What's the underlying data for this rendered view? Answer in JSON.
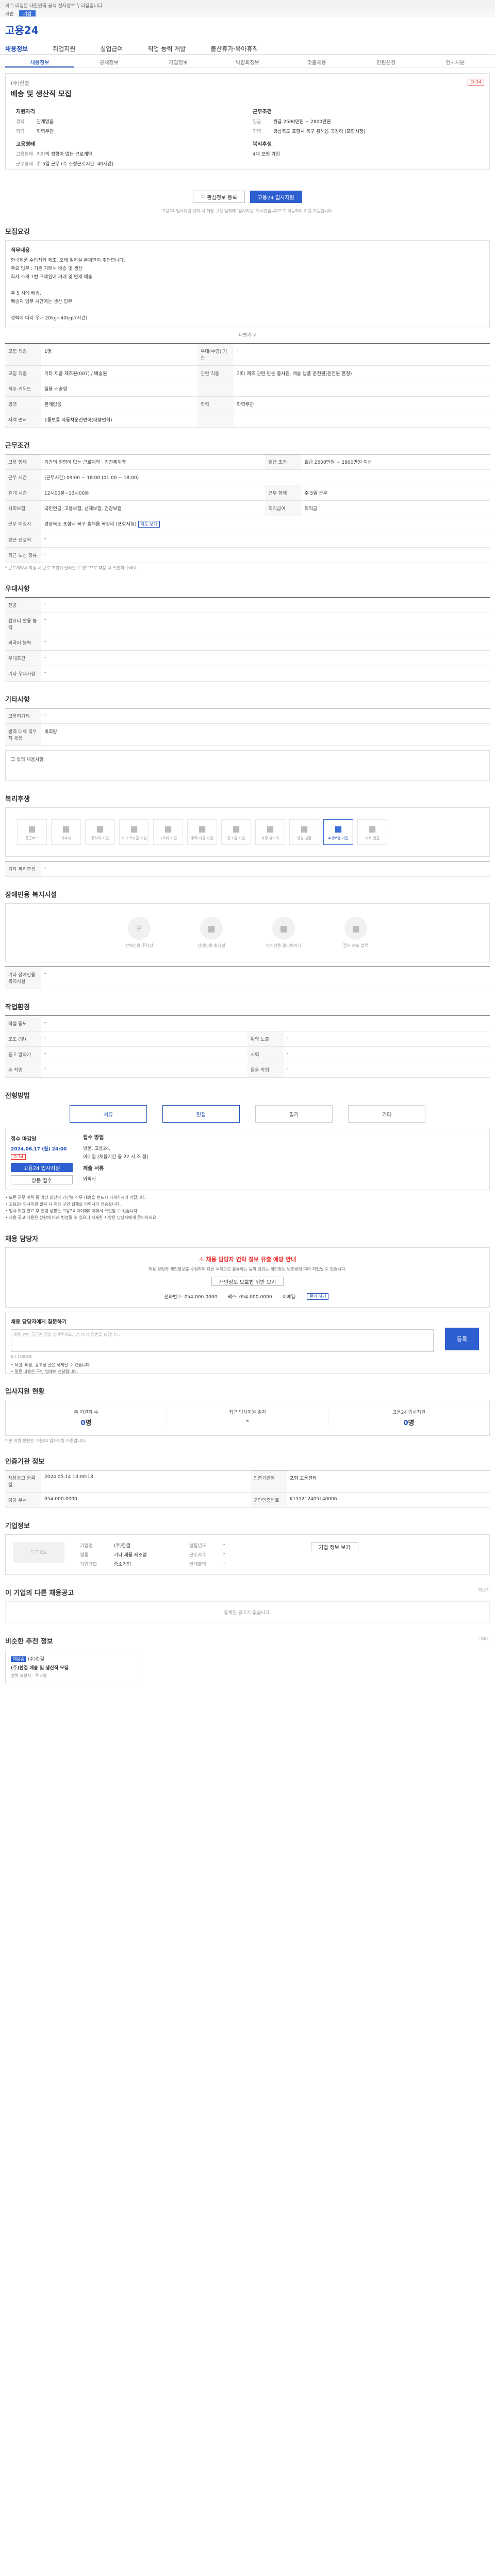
{
  "top": {
    "notice": "이 누리집은 대한민국 공식 전자정부 누리집입니다.",
    "tabs": [
      "개인",
      "기업"
    ],
    "logo": "고용24",
    "gnb": [
      "채용정보",
      "취업지원",
      "실업급여",
      "직업 능력 개발",
      "출산휴가·육아휴직"
    ],
    "subnav": [
      "채용정보",
      "공채정보",
      "기업정보",
      "박람회정보",
      "맞춤채용",
      "민원신청",
      "인사처분"
    ]
  },
  "job": {
    "company": "(주)한결",
    "title": "배송 및 생산직 모집",
    "dday": "D-34",
    "summary_h1": "지원자격",
    "summary_h2": "근무조건",
    "rows_left": [
      {
        "k": "경력",
        "v": "관계없음"
      },
      {
        "k": "학력",
        "v": "학력무관"
      }
    ],
    "form_h": "고용형태",
    "form_rows": [
      {
        "k": "고용형태",
        "v": "기간의 정함이 없는 근로계약"
      },
      {
        "k": "근무형태",
        "v": "주 5일 근무 (주 소정근로시간: 40시간)"
      }
    ],
    "rows_right": [
      {
        "k": "임금",
        "v": "월급 2500만원 ~ 2800만원"
      },
      {
        "k": "지역",
        "v": "경상북도 포항시 북구 흥해읍 곡강리 (포항시청)"
      }
    ],
    "welfare_h": "복리후생",
    "welfare": "4대 보험 가입",
    "btn_scrap": "관심정보 등록",
    "btn_apply": "고용24 입사지원",
    "notice": "고용24 입사지원 선택 시 해당 구인 업체에 ‘입사지원’ 하시겠습니까? 로 이동하여 지원 가능합니다."
  },
  "recruit": {
    "h": "모집요강",
    "desc_h": "직무내용",
    "desc": "한국제품 수입처와 제조, 오래 일하실 분께만이 추천합니다.\n주요 업무 : 기존 거래처 배송 및 생산\n회사 소개 1번 프레임에 거래 및 면세 배송\n\n주 5 시에 배송,\n배송지 업무 시간에는 생산 업무\n\n경력에 따라 우대 20kg~40kg(7시간)",
    "more": "더보기 ∨",
    "table": [
      {
        "k": "모집 직종",
        "v": "1명",
        "k2": "우대(수령) 기간",
        "v2": "-"
      },
      {
        "k": "모집 직종",
        "v": "기타 제품 제조원(007) / 배송원",
        "k2": "관련 직종",
        "v2": "기타 제조 관련 단순 종사원, 배송 납품 운전원(운전원 한정)"
      },
      {
        "k": "직무 키워드",
        "v": "일용 배송업",
        "k2": "",
        "v2": ""
      },
      {
        "k": "경력",
        "v": "관계없음",
        "k2": "학력",
        "v2": "학력무관"
      },
      {
        "k": "자격 면허",
        "v": "1종보통 자동차운전면허(대형면허)",
        "k2": "",
        "v2": ""
      }
    ]
  },
  "work": {
    "h": "근무조건",
    "table": [
      {
        "k": "고용 형태",
        "v": "기간의 정함이 없는 근로계약 · 기간제계약",
        "k2": "임금 조건",
        "v2": "월급 2500만원 ~ 2800만원 이상"
      },
      {
        "k": "근무 시간",
        "v": "(근무시간) 09:00 ~ 18:00 (01:00 ~ 18:00)",
        "k2": "",
        "v2": ""
      },
      {
        "k": "휴게 시간",
        "v": "12시00분~13시00분",
        "k2": "근무 형태",
        "v2": "주 5일 근무"
      },
      {
        "k": "사회보험",
        "v": "국민연금, 고용보험, 산재보험, 건강보험",
        "k2": "퇴직급여",
        "v2": "퇴직금"
      },
      {
        "k": "근무 예정지",
        "v": "경상북도 포항시 북구 흥해읍 곡강리 (포항시청)",
        "k2": "",
        "v2": ""
      },
      {
        "k": "인근 전철역",
        "v": "-",
        "k2": "",
        "v2": ""
      },
      {
        "k": "최근 노선 정류",
        "v": "-",
        "k2": "",
        "v2": ""
      }
    ],
    "note": "* 근로계약서 작성 시 근로 조건이 달라질 수 있으므로 채용 시 확인해 주세요.",
    "map_btn": "지도 보기"
  },
  "pref": {
    "h": "우대사항",
    "table": [
      {
        "k": "전공",
        "v": "-"
      },
      {
        "k": "컴퓨터 활용 능력",
        "v": "-"
      },
      {
        "k": "외국어 능력",
        "v": "-"
      },
      {
        "k": "우대조건",
        "v": "-"
      },
      {
        "k": "기타 우대사항",
        "v": "-"
      }
    ]
  },
  "etc": {
    "h": "기타사항",
    "table": [
      {
        "k": "고용허가제",
        "v": "-"
      },
      {
        "k": "병역 대체 복무자 채용",
        "v": "비희망"
      }
    ],
    "box": "그 밖의 채용사항"
  },
  "welfare": {
    "h": "복리후생",
    "items": [
      "통근버스",
      "기숙사",
      "중식비 지원",
      "자녀 학자금 지원",
      "교육비 지원",
      "주택 자금 지원",
      "경조금 지원",
      "차량 유지비",
      "생일 선물",
      "4대보험 가입",
      "퇴직 연금"
    ],
    "active_index": 9,
    "other_k": "기타 복리후생",
    "other_v": "-"
  },
  "disabled": {
    "h": "장애인용 복지시설",
    "items": [
      "장애인용 주차장",
      "장애인용 화장실",
      "장애인용 엘리베이터",
      "점자 보도 블럭"
    ],
    "other_k": "기타 장애인용 복지시설",
    "other_v": "-"
  },
  "env": {
    "h": "작업환경",
    "rows": [
      {
        "k": "작업 동도",
        "v": "-"
      },
      {
        "k": "조도 (빛)",
        "v": "-",
        "k2": "위험 노출",
        "v2": "-"
      },
      {
        "k": "듣고 말하기",
        "v": "-",
        "k2": "시력",
        "v2": "-"
      },
      {
        "k": "손 작업",
        "v": "-",
        "k2": "들을 작업",
        "v2": "-"
      }
    ]
  },
  "process": {
    "h": "전형방법",
    "steps": [
      "서류",
      "면접",
      "필기",
      "기타"
    ],
    "active": [
      0,
      1
    ],
    "apply_h": "접수 마감일",
    "apply_date": "2024.06.17 (월) 24:00",
    "apply_dd": "D-34",
    "apply_btn": "고용24 입사지원",
    "apply_btn2": "방문 접수",
    "method_h": "접수 방법",
    "method": "방문, 고용24,\n이메일 (채용기간 등 22 시 조 정)",
    "docs_h": "제출 서류",
    "docs": "이력서",
    "bullets": [
      "• 모든 근무 이력 중 가장 최신의 기간별 직무 내용을 반드시 기재하시기 바랍니다.",
      "• 고용24 입사지원 클릭 시 해당 구인 업체로 이력서가 전송됩니다.",
      "• 입사 지원 완료 후 진행 상황은 고용24 마이페이지에서 확인할 수 있습니다.",
      "• 채용 공고 내용은 상황에 따라 변경될 수 있으니 자세한 사항은 담당자에게 문의하세요."
    ]
  },
  "manager": {
    "h": "채용 담당자",
    "warn_title": "채용 담당자 연락 정보 유출 예방 안내",
    "warn_text": "채용 담당자 개인정보를 수집하여 다른 목적으로 활용하는 등의 행위는 개인정보 보호법에 따라 처벌될 수 있습니다.",
    "warn_btn": "개인정보 보호법 위반 보기",
    "contact": [
      {
        "k": "전화번호",
        "v": "054-000-0000"
      },
      {
        "k": "팩스",
        "v": "054-000-0000"
      },
      {
        "k": "이메일",
        "v": ""
      }
    ],
    "contact_btn": "문의 하기",
    "qa_h": "채용 담당자에게 질문하기",
    "qa_placeholder": "채용 관련 궁금한 점을 남겨주세요. 담당자가 답변을 드립니다.",
    "qa_count": "0 / 1000자",
    "qa_btn": "등록",
    "qa_bullets": [
      "• 욕설, 비방, 광고성 글은 삭제될 수 있습니다.",
      "• 질문 내용은 구인 업체에 전달됩니다."
    ]
  },
  "status": {
    "h": "입사지원 현황",
    "items": [
      {
        "k": "총 지원자 수",
        "v": "0",
        "u": "명"
      },
      {
        "k": "최근 입사지원 일자",
        "v": "",
        "u": "-"
      },
      {
        "k": "고용24 입사지원",
        "v": "0",
        "u": "명"
      }
    ],
    "note": "* 본 지원 현황은 고용24 입사지원 기준입니다."
  },
  "meta": {
    "h": "인증기관 정보",
    "table": [
      {
        "k": "채용공고 등록일",
        "v": "2024.05.14 10:00:13",
        "k2": "인증기관명",
        "v2": "포항 고용센터"
      },
      {
        "k": "담당 부서",
        "v": "054-000-0000",
        "k2": "구인인증번호",
        "v2": "K151212405140006"
      }
    ]
  },
  "company": {
    "h": "기업정보",
    "logo": "로고 없음",
    "rows": [
      {
        "k": "기업명",
        "v": "(주)한결",
        "k2": "설립년도",
        "v2": "-"
      },
      {
        "k": "업종",
        "v": "기타 제품 제조업",
        "k2": "근로자수",
        "v2": "-"
      },
      {
        "k": "기업규모",
        "v": "중소기업",
        "k2": "연매출액",
        "v2": "-"
      }
    ],
    "btn": "기업 정보 보기"
  },
  "related": {
    "h": "이 기업의 다른 채용공고",
    "more": "더보기",
    "empty": "등록된 공고가 없습니다."
  },
  "recommend": {
    "h": "비슷한 추천 정보",
    "more": "더보기",
    "badge": "채용중",
    "company": "(주)한결",
    "title": "(주)한결 배송 및 생산직 모집",
    "meta": "경북 포항시 · 주 5일"
  }
}
